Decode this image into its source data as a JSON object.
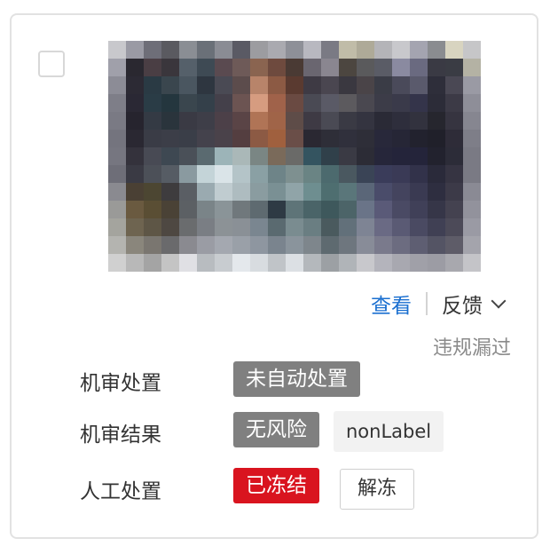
{
  "card": {
    "actions": {
      "view_label": "查看",
      "feedback_label": "反馈",
      "violation_label": "违规漏过"
    },
    "rows": [
      {
        "label": "机审处置",
        "tags": [
          "未自动处置"
        ]
      },
      {
        "label": "机审结果",
        "tags": [
          "无风险",
          "nonLabel"
        ]
      },
      {
        "label": "人工处置",
        "tags": [
          "已冻结"
        ],
        "button": "解冻"
      }
    ]
  },
  "colors": {
    "link": "#1a6fd0",
    "tag_gray": "#808080",
    "tag_red": "#d9141f"
  },
  "icons": {
    "feedback_dropdown": "chevron-down-icon"
  }
}
